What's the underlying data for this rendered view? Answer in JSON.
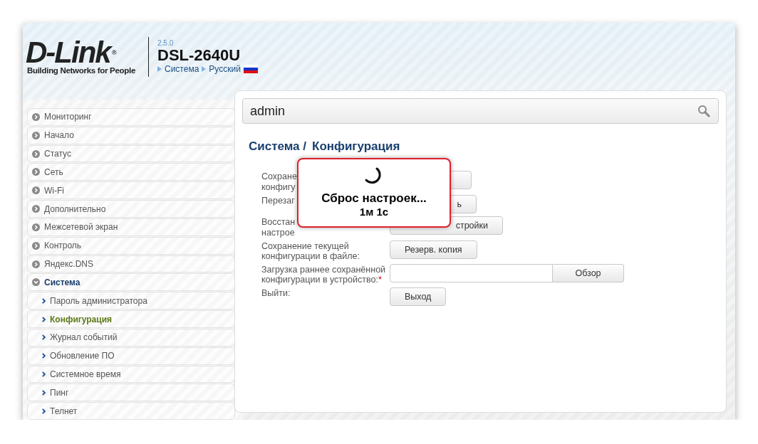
{
  "header": {
    "logo": {
      "wordmark": "D-Link",
      "registered": "®",
      "tagline": "Building Networks for People"
    },
    "version": "2.5.0",
    "model": "DSL-2640U",
    "breadcrumbs": [
      "Система",
      "Русский"
    ]
  },
  "sidebar": {
    "items": [
      {
        "label": "Мониторинг",
        "expanded": false
      },
      {
        "label": "Начало",
        "expanded": false
      },
      {
        "label": "Статус",
        "expanded": false
      },
      {
        "label": "Сеть",
        "expanded": false
      },
      {
        "label": "Wi-Fi",
        "expanded": false
      },
      {
        "label": "Дополнительно",
        "expanded": false
      },
      {
        "label": "Межсетевой экран",
        "expanded": false
      },
      {
        "label": "Контроль",
        "expanded": false
      },
      {
        "label": "Яндекс.DNS",
        "expanded": false
      },
      {
        "label": "Система",
        "expanded": true,
        "children": [
          {
            "label": "Пароль администратора",
            "selected": false
          },
          {
            "label": "Конфигурация",
            "selected": true
          },
          {
            "label": "Журнал событий",
            "selected": false
          },
          {
            "label": "Обновление ПО",
            "selected": false
          },
          {
            "label": "Системное время",
            "selected": false
          },
          {
            "label": "Пинг",
            "selected": false
          },
          {
            "label": "Телнет",
            "selected": false
          }
        ]
      }
    ]
  },
  "search": {
    "value": "admin"
  },
  "page_title": {
    "section": "Система /",
    "page": "Конфигурация"
  },
  "form_rows": [
    {
      "kind": "button",
      "label_lines": [
        "Сохране",
        "конфигу"
      ]
    },
    {
      "kind": "button",
      "label_lines": [
        "Перезаг"
      ],
      "button": "ь"
    },
    {
      "kind": "button",
      "label_lines": [
        "Восстан",
        "настрое"
      ],
      "button": "стройки"
    },
    {
      "kind": "button",
      "label": "Сохранение текущей конфигурации в файле:",
      "button": "Резерв. копия"
    },
    {
      "kind": "file",
      "label": "Загрузка раннее сохранённой конфигурации в устройство:",
      "required_mark": "*",
      "button": "Обзор"
    },
    {
      "kind": "button",
      "label": "Выйти:",
      "button": "Выход"
    }
  ],
  "overlay": {
    "message": "Сброс настроек...",
    "timer": "1м 1с"
  }
}
